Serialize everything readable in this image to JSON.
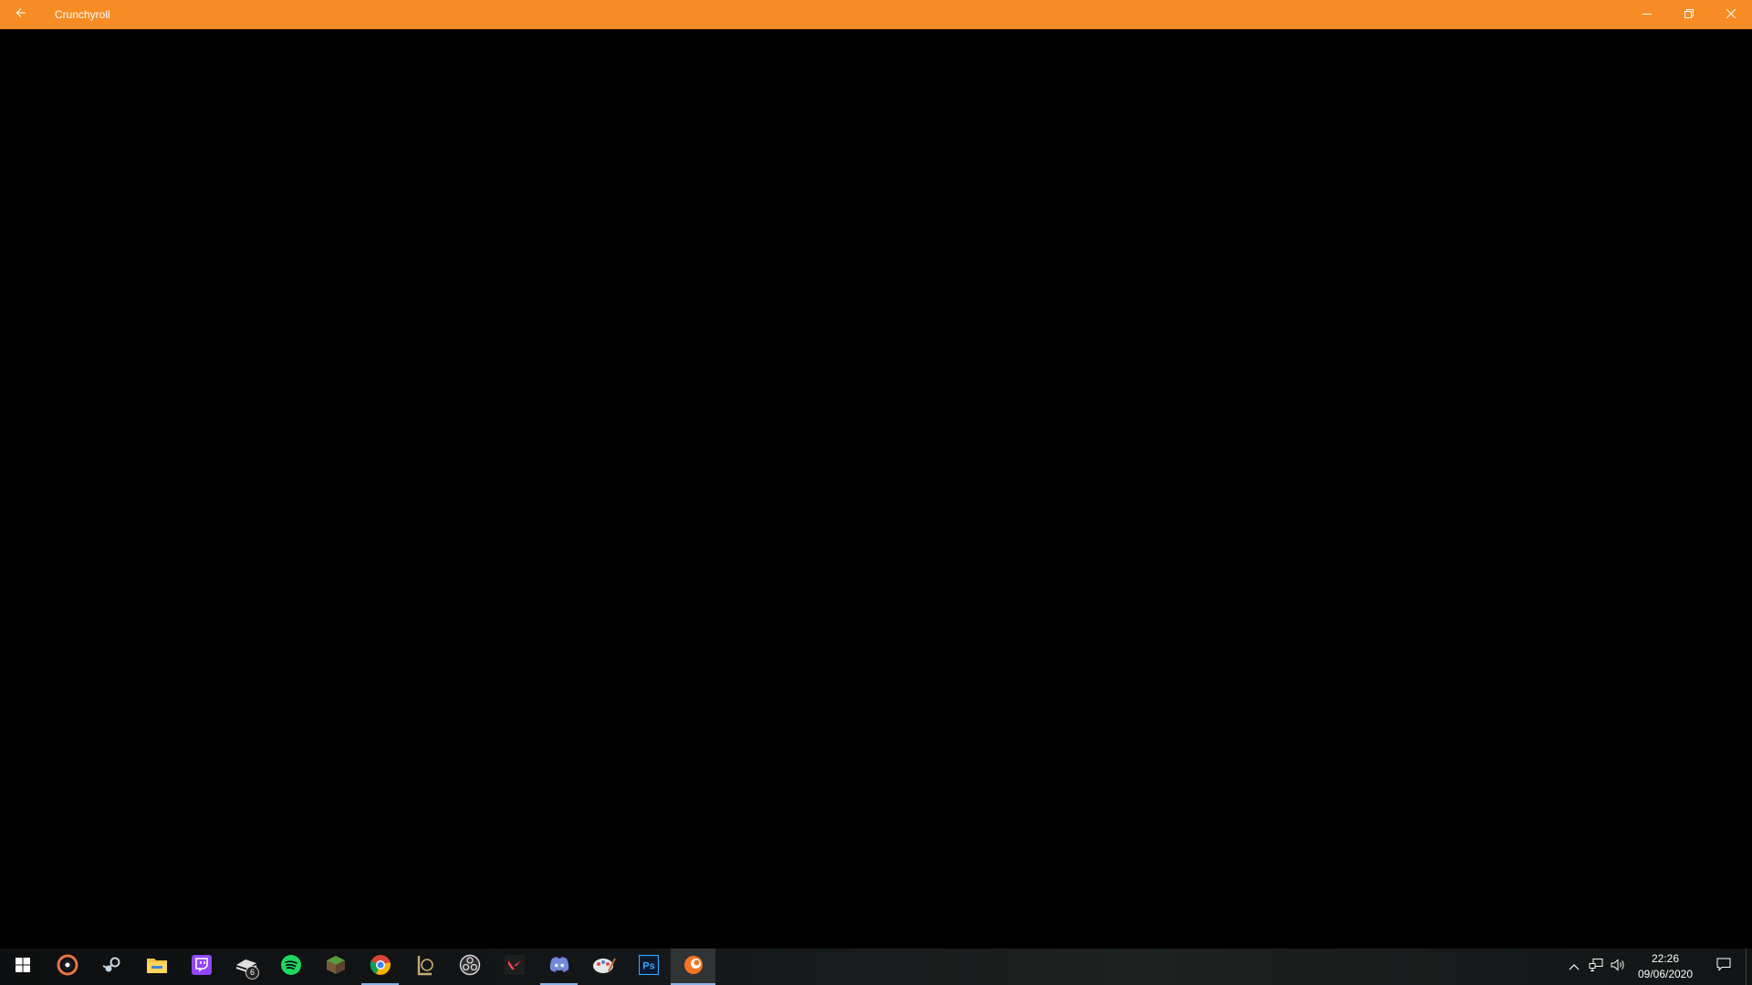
{
  "window": {
    "title": "Crunchyroll",
    "titlebar_color": "#f78c25",
    "back_icon": "arrow-left-icon",
    "minimize_icon": "minimize-icon",
    "restore_icon": "restore-icon",
    "close_icon": "close-icon"
  },
  "taskbar": {
    "start_icon": "windows-logo-icon",
    "apps": [
      {
        "name": "groove-music",
        "icon": "groove-music-icon"
      },
      {
        "name": "steam",
        "icon": "steam-icon"
      },
      {
        "name": "file-explorer",
        "icon": "folder-icon"
      },
      {
        "name": "twitch",
        "icon": "twitch-icon"
      },
      {
        "name": "stacked-app",
        "icon": "stack-icon",
        "badge": "6"
      },
      {
        "name": "spotify",
        "icon": "spotify-icon"
      },
      {
        "name": "minecraft",
        "icon": "grass-block-icon"
      },
      {
        "name": "chrome",
        "icon": "chrome-icon"
      },
      {
        "name": "league-of-legends",
        "icon": "league-icon"
      },
      {
        "name": "obs",
        "icon": "obs-icon"
      },
      {
        "name": "valorant",
        "icon": "valorant-icon"
      },
      {
        "name": "discord",
        "icon": "discord-icon"
      },
      {
        "name": "paint-app",
        "icon": "paint-icon"
      },
      {
        "name": "photoshop",
        "icon": "photoshop-icon",
        "label": "Ps"
      },
      {
        "name": "crunchyroll",
        "icon": "crunchyroll-icon"
      }
    ],
    "tray": {
      "chevron_icon": "chevron-up-icon",
      "network_icon": "network-icon",
      "volume_icon": "volume-icon",
      "time": "22:26",
      "date": "09/06/2020",
      "notification_icon": "action-center-icon"
    }
  }
}
